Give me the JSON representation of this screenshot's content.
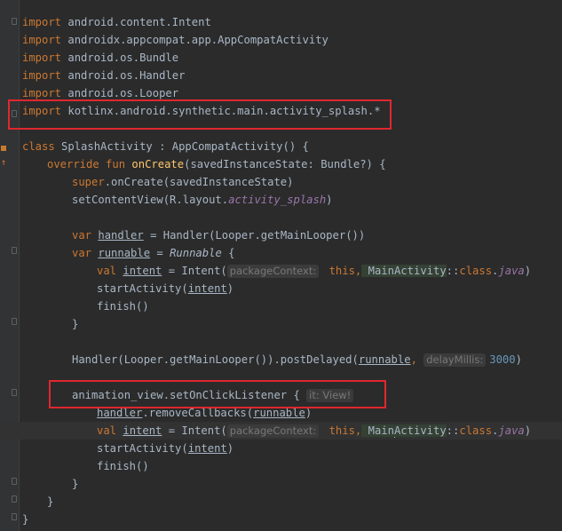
{
  "editor": {
    "lines": {
      "l1": {
        "kw": "import",
        "rest": " android.content.Intent"
      },
      "l2": {
        "kw": "import",
        "rest": " androidx.appcompat.app.AppCompatActivity"
      },
      "l3": {
        "kw": "import",
        "rest": " android.os.Bundle"
      },
      "l4": {
        "kw": "import",
        "rest": " android.os.Handler"
      },
      "l5": {
        "kw": "import",
        "rest": " android.os.Looper"
      },
      "l6": {
        "kw": "import",
        "rest": " kotlinx.android.synthetic.main.activity_splash.*"
      },
      "l8": {
        "kw": "class",
        "name": " SplashActivity",
        "rest": " : AppCompatActivity() {"
      },
      "l9": {
        "kw": "override fun",
        "name": " onCreate",
        "rest": "(savedInstanceState: Bundle?) {"
      },
      "l10": {
        "kw": "super",
        "rest": ".onCreate(savedInstanceState)"
      },
      "l11": {
        "pre": "setContentView(R.layout.",
        "ital": "activity_splash",
        "post": ")"
      },
      "l13": {
        "kw": "var",
        "var": "handler",
        "rest": " = Handler(Looper.getMainLooper())"
      },
      "l14": {
        "kw": "var",
        "var": "runnable",
        "mid": " = ",
        "type": "Runnable",
        "rest": " {"
      },
      "l15": {
        "kw": "val",
        "var": "intent",
        "pre": " = Intent(",
        "hint": "packageContext:",
        "this": " this,",
        "cls": " MainActivity",
        "mid": "::",
        "kw2": "class",
        ".": ".",
        "ital": "java",
        "post": ")"
      },
      "l16": {
        "pre": "startActivity(",
        "var": "intent",
        "post": ")"
      },
      "l17": {
        "text": "finish()"
      },
      "l18": {
        "text": "}"
      },
      "l20": {
        "pre": "Handler(Looper.getMainLooper()).postDelayed(",
        "var": "runnable",
        "comma": ",",
        "hint": "delayMillis:",
        "num": "3000",
        "post": ")"
      },
      "l22": {
        "pre": "animation_view.setOnClickListener {",
        "hint": "it: View!"
      },
      "l23": {
        "var": "handler",
        "pre": ".removeCallbacks(",
        "var2": "runnable",
        "post": ")"
      },
      "l24": {
        "kw": "val",
        "var": "intent",
        "pre": " = Intent(",
        "hint": "packageContext:",
        "this": " this,",
        "cls_a": " Main",
        "cls_b": "Activity",
        "mid": "::",
        "kw2": "class",
        ".": ".",
        "ital": "java",
        "post": ")"
      },
      "l25": {
        "pre": "startActivity(",
        "var": "intent",
        "post": ")"
      },
      "l26": {
        "text": "finish()"
      },
      "l27": {
        "text": "}"
      },
      "l28": {
        "text": "}"
      },
      "l29": {
        "text": "}"
      }
    }
  },
  "colors": {
    "background": "#2b2b2b",
    "keyword": "#cc7832",
    "function": "#ffc66d",
    "number": "#6897bb",
    "highlight_box": "#e0272e"
  }
}
